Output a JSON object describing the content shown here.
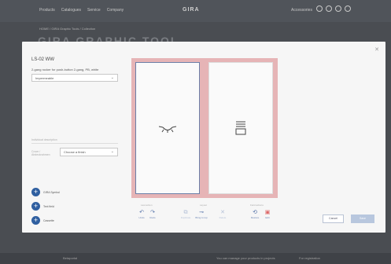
{
  "background": {
    "nav": [
      "Products",
      "Catalogues",
      "Service",
      "Company"
    ],
    "logo": "GIRA",
    "accessories": "Accessories",
    "breadcrumb": "HOME / GIRA Graphic Tools / Collection",
    "headline": "GIRA GRAPHIC TOOL",
    "footer_left": "Betaportal",
    "footer_right": "You can manage your products in projects",
    "footer_right2": "For registration"
  },
  "modal": {
    "close_icon": "close-icon",
    "product_code": "LS-02 WW",
    "product_description": "2-gang rocker for push-button 2-gang, PB, white",
    "main_select_value": "Impermeable",
    "field_label": "Individual description",
    "cover_label": "Cover / Abdeckrahmen",
    "cover_select_value": "Choose a finish",
    "side_buttons": [
      {
        "icon": "plus-icon",
        "label": "GIRA Symbol"
      },
      {
        "icon": "plus-icon",
        "label": "Text field"
      },
      {
        "icon": "plus-icon",
        "label": "Cassette"
      }
    ],
    "tool_groups": [
      "Last action",
      "Layout",
      "Field actions"
    ],
    "tools": [
      {
        "icon": "undo-icon",
        "label": "Undo"
      },
      {
        "icon": "redo-icon",
        "label": "Redo"
      },
      {
        "icon": "copy-icon",
        "label": "Duplicate"
      },
      {
        "icon": "link-icon",
        "label": "Bring to top"
      },
      {
        "icon": "close-icon",
        "label": "Delete"
      },
      {
        "icon": "restore-icon",
        "label": "Restore"
      },
      {
        "icon": "edit-icon",
        "label": "Edit"
      }
    ],
    "cancel_label": "Cancel",
    "save_label": "Save"
  },
  "colors": {
    "preview_frame": "#e6b4b6",
    "selected_border": "#6b7fa8",
    "accent_blue": "#2f5fa0"
  }
}
